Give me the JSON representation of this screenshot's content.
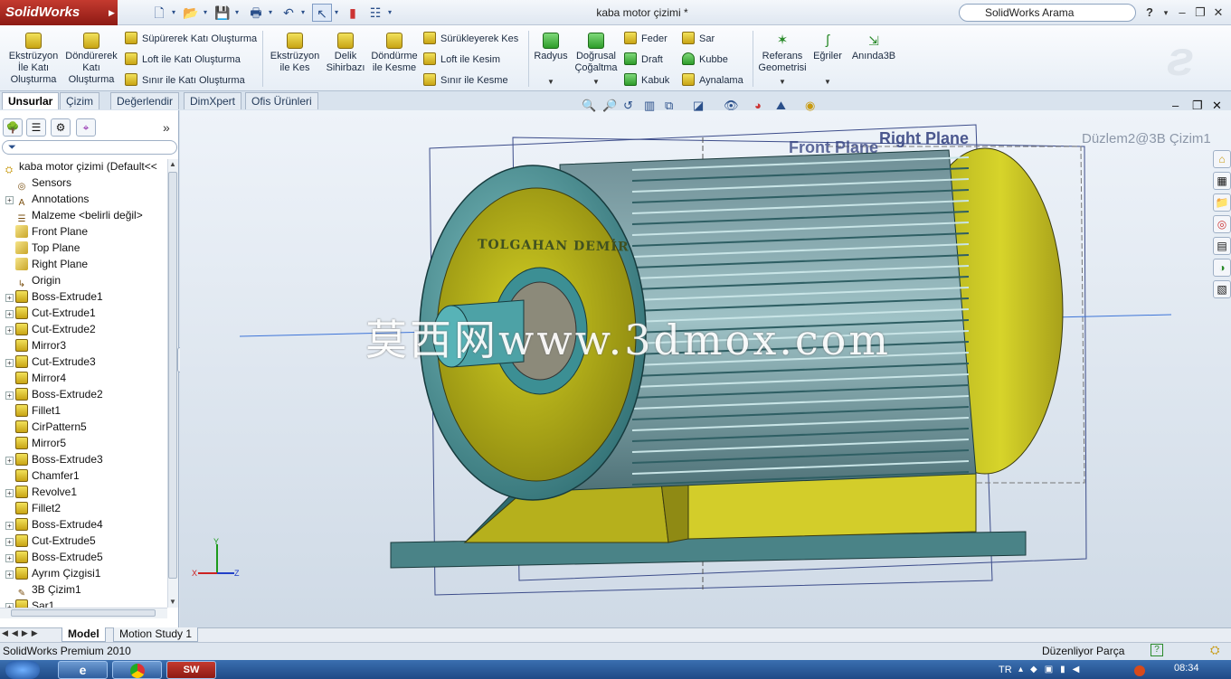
{
  "titlebar": {
    "app_logo": "SolidWorks",
    "document_title": "kaba motor çizimi *",
    "search_placeholder": "SolidWorks Arama",
    "help_label": "?"
  },
  "ribbon": {
    "big_buttons_1": [
      {
        "label": "Ekstrüzyon İle Katı Oluşturma",
        "icon": "extrude-boss-icon"
      },
      {
        "label": "Döndürerek Katı Oluşturma",
        "icon": "revolve-boss-icon"
      }
    ],
    "rows_1": [
      "Süpürerek Katı Oluşturma",
      "Loft ile Katı Oluşturma",
      "Sınır ile Katı Oluşturma"
    ],
    "big_buttons_2": [
      {
        "label": "Ekstrüzyon ile Kes",
        "icon": "extrude-cut-icon"
      },
      {
        "label": "Delik Sihirbazı",
        "icon": "hole-wizard-icon"
      },
      {
        "label": "Döndürme ile Kesme",
        "icon": "revolve-cut-icon"
      }
    ],
    "rows_2": [
      "Sürükleyerek Kes",
      "Loft ile Kesim",
      "Sınır ile Kesme"
    ],
    "big_buttons_3": [
      {
        "label": "Radyus",
        "icon": "fillet-icon"
      },
      {
        "label": "Doğrusal Çoğaltma",
        "icon": "linear-pattern-icon"
      }
    ],
    "rows_3a": [
      "Feder",
      "Draft",
      "Kabuk"
    ],
    "rows_3b": [
      "Sar",
      "Kubbe",
      "Aynalama"
    ],
    "big_buttons_4": [
      {
        "label": "Referans Geometrisi",
        "icon": "reference-geometry-icon"
      },
      {
        "label": "Eğriler",
        "icon": "curves-icon"
      },
      {
        "label": "Anında3B",
        "icon": "instant3d-icon"
      }
    ]
  },
  "command_tabs": [
    "Unsurlar",
    "Çizim",
    "Değerlendir",
    "DimXpert",
    "Ofis Ürünleri"
  ],
  "feature_tree": {
    "root": "kaba motor çizimi  (Default<<",
    "items": [
      {
        "label": "Sensors",
        "expandable": false
      },
      {
        "label": "Annotations",
        "expandable": true
      },
      {
        "label": "Malzeme <belirli değil>",
        "expandable": false
      },
      {
        "label": "Front Plane",
        "expandable": false
      },
      {
        "label": "Top Plane",
        "expandable": false
      },
      {
        "label": "Right Plane",
        "expandable": false
      },
      {
        "label": "Origin",
        "expandable": false
      },
      {
        "label": "Boss-Extrude1",
        "expandable": true
      },
      {
        "label": "Cut-Extrude1",
        "expandable": true
      },
      {
        "label": "Cut-Extrude2",
        "expandable": true
      },
      {
        "label": "Mirror3",
        "expandable": false
      },
      {
        "label": "Cut-Extrude3",
        "expandable": true
      },
      {
        "label": "Mirror4",
        "expandable": false
      },
      {
        "label": "Boss-Extrude2",
        "expandable": true
      },
      {
        "label": "Fillet1",
        "expandable": false
      },
      {
        "label": "CirPattern5",
        "expandable": false
      },
      {
        "label": "Mirror5",
        "expandable": false
      },
      {
        "label": "Boss-Extrude3",
        "expandable": true
      },
      {
        "label": "Chamfer1",
        "expandable": false
      },
      {
        "label": "Revolve1",
        "expandable": true
      },
      {
        "label": "Fillet2",
        "expandable": false
      },
      {
        "label": "Boss-Extrude4",
        "expandable": true
      },
      {
        "label": "Cut-Extrude5",
        "expandable": true
      },
      {
        "label": "Boss-Extrude5",
        "expandable": true
      },
      {
        "label": "Ayrım Çizgisi1",
        "expandable": true
      },
      {
        "label": "3B Çizim1",
        "expandable": false
      },
      {
        "label": "Sar1",
        "expandable": true
      }
    ]
  },
  "viewport": {
    "plane_labels": {
      "front": "Front Plane",
      "right": "Right Plane"
    },
    "sketch_label": "Düzlem2@3B Çizim1",
    "engraving": "TOLGAHAN DEMİR",
    "watermark": "莫西网www.3dmox.com",
    "axis_labels": {
      "y": "Y",
      "x": "X",
      "z": "Z"
    }
  },
  "bottom_tabs": [
    "Model",
    "Motion Study 1"
  ],
  "status": {
    "product": "SolidWorks Premium 2010",
    "mode": "Düzenliyor Parça"
  },
  "taskbar": {
    "language": "TR",
    "clock": "08:34"
  }
}
